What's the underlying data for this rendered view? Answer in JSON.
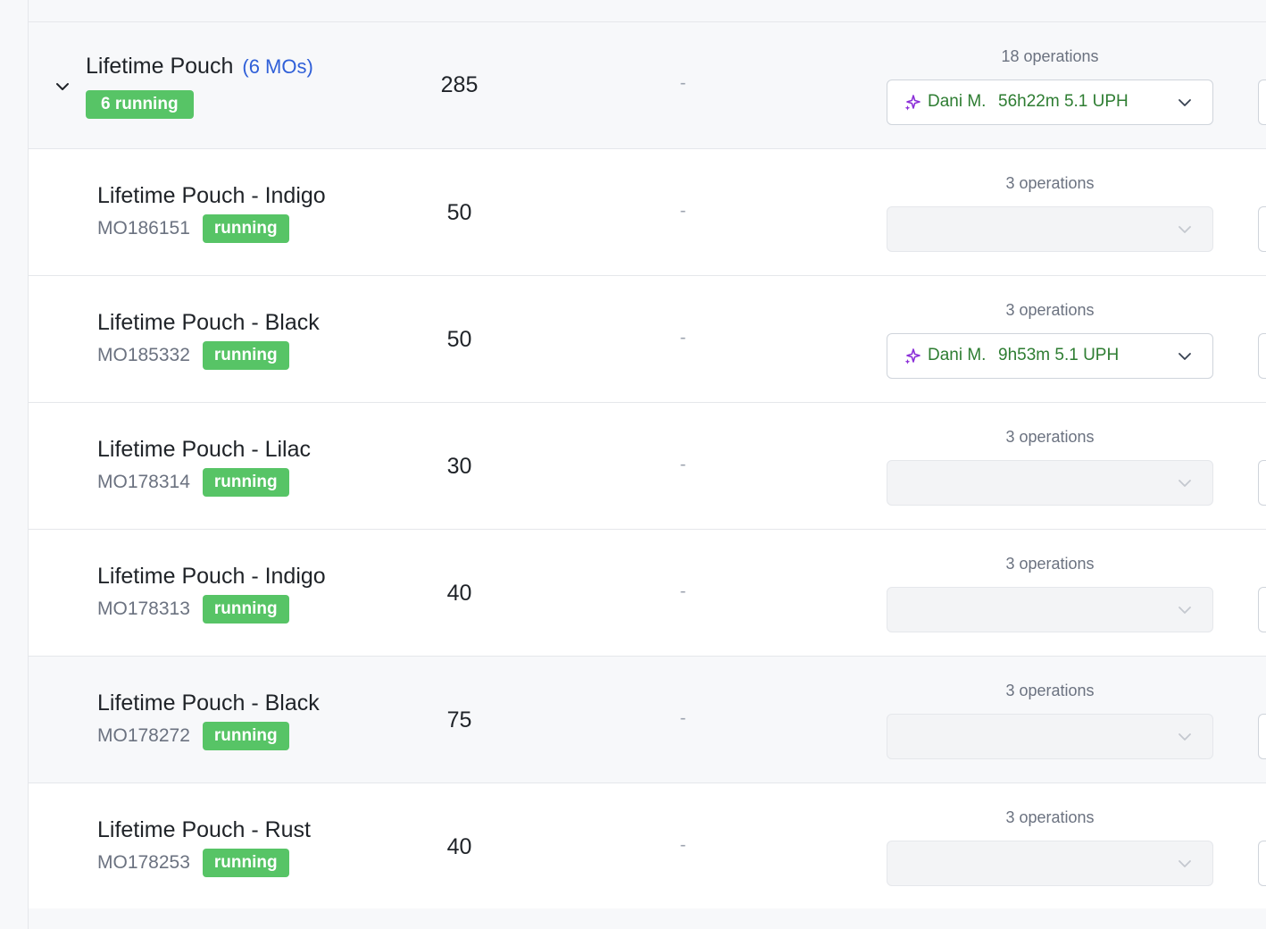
{
  "group": {
    "title": "Lifetime Pouch",
    "mo_count": "(6 MOs)",
    "status": "6 running",
    "quantity": "285",
    "dash": "-",
    "operations": "18 operations",
    "assignee": "Dani M.",
    "eta": "56h22m 5.1 UPH"
  },
  "items": [
    {
      "title": "Lifetime Pouch - Indigo",
      "mo": "MO186151",
      "status": "running",
      "quantity": "50",
      "dash": "-",
      "operations": "3 operations",
      "assignee": "",
      "eta": ""
    },
    {
      "title": "Lifetime Pouch - Black",
      "mo": "MO185332",
      "status": "running",
      "quantity": "50",
      "dash": "-",
      "operations": "3 operations",
      "assignee": "Dani M.",
      "eta": "9h53m 5.1 UPH"
    },
    {
      "title": "Lifetime Pouch - Lilac",
      "mo": "MO178314",
      "status": "running",
      "quantity": "30",
      "dash": "-",
      "operations": "3 operations",
      "assignee": "",
      "eta": ""
    },
    {
      "title": "Lifetime Pouch - Indigo",
      "mo": "MO178313",
      "status": "running",
      "quantity": "40",
      "dash": "-",
      "operations": "3 operations",
      "assignee": "",
      "eta": ""
    },
    {
      "title": "Lifetime Pouch - Black",
      "mo": "MO178272",
      "status": "running",
      "quantity": "75",
      "dash": "-",
      "operations": "3 operations",
      "assignee": "",
      "eta": ""
    },
    {
      "title": "Lifetime Pouch - Rust",
      "mo": "MO178253",
      "status": "running",
      "quantity": "40",
      "dash": "-",
      "operations": "3 operations",
      "assignee": "",
      "eta": ""
    }
  ],
  "icons": {
    "toggle": "chevron-down-icon",
    "assignee": "sparkle-icon",
    "dropdown": "chevron-down-icon"
  },
  "colors": {
    "running_badge": "#57c466",
    "mo_count_link": "#2f5fd8",
    "assignee_text": "#2e7d32",
    "sparkle": "#8b2fd8",
    "row_alt": "#f7f8fa"
  }
}
